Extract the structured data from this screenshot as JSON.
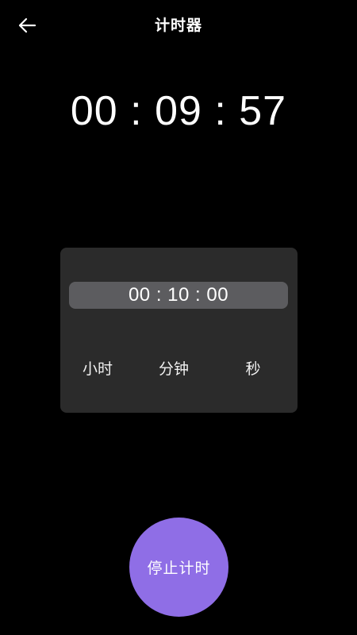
{
  "header": {
    "title": "计时器",
    "back_icon": "arrow-left-icon"
  },
  "timer": {
    "remaining": "00 : 09 : 57"
  },
  "picker": {
    "selected_value": "00 : 10 : 00",
    "labels": {
      "hours": "小时",
      "minutes": "分钟",
      "seconds": "秒"
    }
  },
  "actions": {
    "stop_label": "停止计时"
  },
  "colors": {
    "background": "#000000",
    "card": "#2b2b2b",
    "selection": "#5c5c5f",
    "accent": "#8f6ee6",
    "text": "#ffffff"
  }
}
